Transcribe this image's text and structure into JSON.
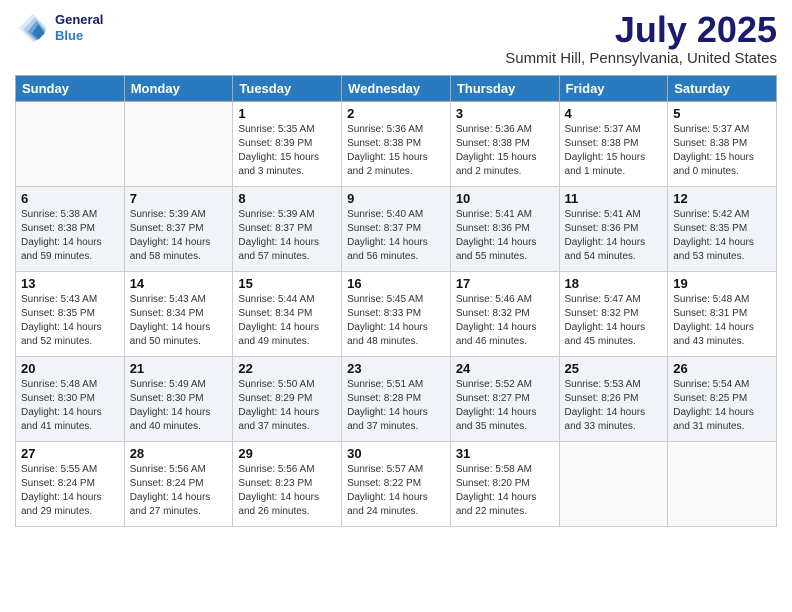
{
  "header": {
    "logo_line1": "General",
    "logo_line2": "Blue",
    "title": "July 2025",
    "subtitle": "Summit Hill, Pennsylvania, United States"
  },
  "calendar": {
    "days_of_week": [
      "Sunday",
      "Monday",
      "Tuesday",
      "Wednesday",
      "Thursday",
      "Friday",
      "Saturday"
    ],
    "weeks": [
      [
        {
          "day": "",
          "empty": true
        },
        {
          "day": "",
          "empty": true
        },
        {
          "day": "1",
          "sunrise": "Sunrise: 5:35 AM",
          "sunset": "Sunset: 8:39 PM",
          "daylight": "Daylight: 15 hours and 3 minutes."
        },
        {
          "day": "2",
          "sunrise": "Sunrise: 5:36 AM",
          "sunset": "Sunset: 8:38 PM",
          "daylight": "Daylight: 15 hours and 2 minutes."
        },
        {
          "day": "3",
          "sunrise": "Sunrise: 5:36 AM",
          "sunset": "Sunset: 8:38 PM",
          "daylight": "Daylight: 15 hours and 2 minutes."
        },
        {
          "day": "4",
          "sunrise": "Sunrise: 5:37 AM",
          "sunset": "Sunset: 8:38 PM",
          "daylight": "Daylight: 15 hours and 1 minute."
        },
        {
          "day": "5",
          "sunrise": "Sunrise: 5:37 AM",
          "sunset": "Sunset: 8:38 PM",
          "daylight": "Daylight: 15 hours and 0 minutes."
        }
      ],
      [
        {
          "day": "6",
          "sunrise": "Sunrise: 5:38 AM",
          "sunset": "Sunset: 8:38 PM",
          "daylight": "Daylight: 14 hours and 59 minutes."
        },
        {
          "day": "7",
          "sunrise": "Sunrise: 5:39 AM",
          "sunset": "Sunset: 8:37 PM",
          "daylight": "Daylight: 14 hours and 58 minutes."
        },
        {
          "day": "8",
          "sunrise": "Sunrise: 5:39 AM",
          "sunset": "Sunset: 8:37 PM",
          "daylight": "Daylight: 14 hours and 57 minutes."
        },
        {
          "day": "9",
          "sunrise": "Sunrise: 5:40 AM",
          "sunset": "Sunset: 8:37 PM",
          "daylight": "Daylight: 14 hours and 56 minutes."
        },
        {
          "day": "10",
          "sunrise": "Sunrise: 5:41 AM",
          "sunset": "Sunset: 8:36 PM",
          "daylight": "Daylight: 14 hours and 55 minutes."
        },
        {
          "day": "11",
          "sunrise": "Sunrise: 5:41 AM",
          "sunset": "Sunset: 8:36 PM",
          "daylight": "Daylight: 14 hours and 54 minutes."
        },
        {
          "day": "12",
          "sunrise": "Sunrise: 5:42 AM",
          "sunset": "Sunset: 8:35 PM",
          "daylight": "Daylight: 14 hours and 53 minutes."
        }
      ],
      [
        {
          "day": "13",
          "sunrise": "Sunrise: 5:43 AM",
          "sunset": "Sunset: 8:35 PM",
          "daylight": "Daylight: 14 hours and 52 minutes."
        },
        {
          "day": "14",
          "sunrise": "Sunrise: 5:43 AM",
          "sunset": "Sunset: 8:34 PM",
          "daylight": "Daylight: 14 hours and 50 minutes."
        },
        {
          "day": "15",
          "sunrise": "Sunrise: 5:44 AM",
          "sunset": "Sunset: 8:34 PM",
          "daylight": "Daylight: 14 hours and 49 minutes."
        },
        {
          "day": "16",
          "sunrise": "Sunrise: 5:45 AM",
          "sunset": "Sunset: 8:33 PM",
          "daylight": "Daylight: 14 hours and 48 minutes."
        },
        {
          "day": "17",
          "sunrise": "Sunrise: 5:46 AM",
          "sunset": "Sunset: 8:32 PM",
          "daylight": "Daylight: 14 hours and 46 minutes."
        },
        {
          "day": "18",
          "sunrise": "Sunrise: 5:47 AM",
          "sunset": "Sunset: 8:32 PM",
          "daylight": "Daylight: 14 hours and 45 minutes."
        },
        {
          "day": "19",
          "sunrise": "Sunrise: 5:48 AM",
          "sunset": "Sunset: 8:31 PM",
          "daylight": "Daylight: 14 hours and 43 minutes."
        }
      ],
      [
        {
          "day": "20",
          "sunrise": "Sunrise: 5:48 AM",
          "sunset": "Sunset: 8:30 PM",
          "daylight": "Daylight: 14 hours and 41 minutes."
        },
        {
          "day": "21",
          "sunrise": "Sunrise: 5:49 AM",
          "sunset": "Sunset: 8:30 PM",
          "daylight": "Daylight: 14 hours and 40 minutes."
        },
        {
          "day": "22",
          "sunrise": "Sunrise: 5:50 AM",
          "sunset": "Sunset: 8:29 PM",
          "daylight": "Daylight: 14 hours and 37 minutes."
        },
        {
          "day": "23",
          "sunrise": "Sunrise: 5:51 AM",
          "sunset": "Sunset: 8:28 PM",
          "daylight": "Daylight: 14 hours and 37 minutes."
        },
        {
          "day": "24",
          "sunrise": "Sunrise: 5:52 AM",
          "sunset": "Sunset: 8:27 PM",
          "daylight": "Daylight: 14 hours and 35 minutes."
        },
        {
          "day": "25",
          "sunrise": "Sunrise: 5:53 AM",
          "sunset": "Sunset: 8:26 PM",
          "daylight": "Daylight: 14 hours and 33 minutes."
        },
        {
          "day": "26",
          "sunrise": "Sunrise: 5:54 AM",
          "sunset": "Sunset: 8:25 PM",
          "daylight": "Daylight: 14 hours and 31 minutes."
        }
      ],
      [
        {
          "day": "27",
          "sunrise": "Sunrise: 5:55 AM",
          "sunset": "Sunset: 8:24 PM",
          "daylight": "Daylight: 14 hours and 29 minutes."
        },
        {
          "day": "28",
          "sunrise": "Sunrise: 5:56 AM",
          "sunset": "Sunset: 8:24 PM",
          "daylight": "Daylight: 14 hours and 27 minutes."
        },
        {
          "day": "29",
          "sunrise": "Sunrise: 5:56 AM",
          "sunset": "Sunset: 8:23 PM",
          "daylight": "Daylight: 14 hours and 26 minutes."
        },
        {
          "day": "30",
          "sunrise": "Sunrise: 5:57 AM",
          "sunset": "Sunset: 8:22 PM",
          "daylight": "Daylight: 14 hours and 24 minutes."
        },
        {
          "day": "31",
          "sunrise": "Sunrise: 5:58 AM",
          "sunset": "Sunset: 8:20 PM",
          "daylight": "Daylight: 14 hours and 22 minutes."
        },
        {
          "day": "",
          "empty": true
        },
        {
          "day": "",
          "empty": true
        }
      ]
    ]
  }
}
